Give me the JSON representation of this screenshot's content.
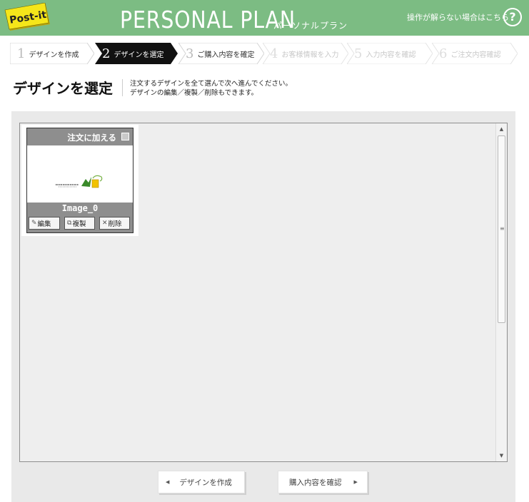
{
  "header": {
    "logo_text": "Post-it",
    "title": "PERSONAL PLAN",
    "subtitle": "パーソナルプラン",
    "help_text": "操作が解らない場合はこちら",
    "help_button": "?"
  },
  "steps": [
    {
      "number": "1",
      "label": "デザインを作成",
      "state": "done"
    },
    {
      "number": "2",
      "label": "デザインを選定",
      "state": "active"
    },
    {
      "number": "3",
      "label": "ご購入内容を確定",
      "state": "next"
    },
    {
      "number": "4",
      "label": "お客様情報を入力",
      "state": "disabled"
    },
    {
      "number": "5",
      "label": "入力内容を確認",
      "state": "disabled"
    },
    {
      "number": "6",
      "label": "ご注文内容確認",
      "state": "disabled"
    }
  ],
  "page": {
    "title": "デザインを選定",
    "description_line1": "注文するデザインを全て選んで次へ進んでください。",
    "description_line2": "デザインの編集／複製／削除もできます。"
  },
  "designs": [
    {
      "add_to_order_label": "注文に加える",
      "selected": false,
      "name": "Image_0",
      "edit_label": "編集",
      "duplicate_label": "複製",
      "delete_label": "削除"
    }
  ],
  "navigation": {
    "back_label": "デザインを作成",
    "next_label": "購入内容を確認"
  },
  "colors": {
    "header_green": "#7cbc83",
    "postit_yellow": "#f5e61a",
    "active_step": "#111111",
    "panel_bg": "#e9e9e9",
    "card_gray": "#8e8e8e"
  }
}
